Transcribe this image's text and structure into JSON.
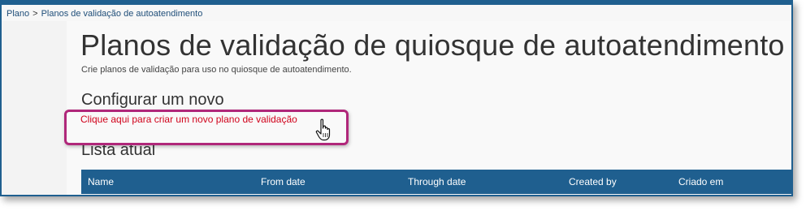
{
  "breadcrumb": {
    "items": [
      "Plano",
      "Planos de validação de autoatendimento"
    ],
    "separator": ">"
  },
  "page": {
    "title": "Planos de validação de quiosque de autoatendimento",
    "subtitle": "Crie planos de validação para uso no quiosque de autoatendimento."
  },
  "configure": {
    "heading": "Configurar um novo",
    "link_label": "Clique aqui para criar um novo plano de validação"
  },
  "list": {
    "heading": "Lista atual",
    "columns": [
      "Name",
      "From date",
      "Through date",
      "Created by",
      "Criado em"
    ]
  },
  "colors": {
    "header_blue": "#1f5f8f",
    "link_red": "#d0021b",
    "highlight_magenta": "#b0277a"
  },
  "icons": {
    "cursor": "hand-pointer-cursor-icon"
  }
}
